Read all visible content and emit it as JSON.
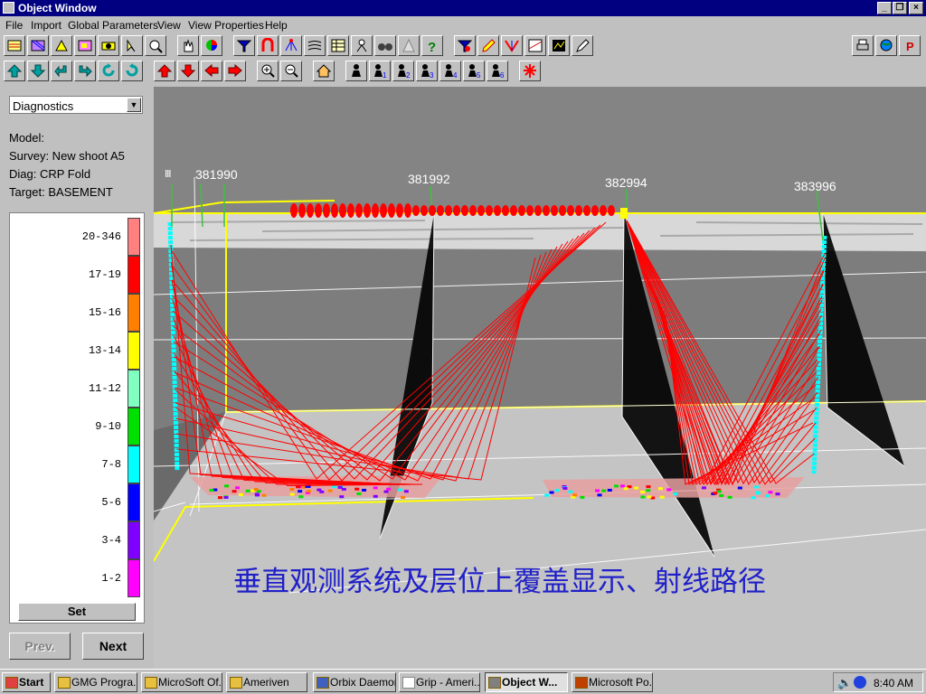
{
  "window": {
    "title": "Object Window"
  },
  "menu": [
    "File",
    "Import",
    "Global Parameters",
    "View",
    "View Properties",
    "Help"
  ],
  "sidebar": {
    "dropdown_value": "Diagnostics",
    "model_label": "Model:",
    "survey": "Survey: New shoot A5",
    "diag": "Diag: CRP Fold",
    "target": "Target: BASEMENT",
    "legend": [
      {
        "label": "20-346",
        "color": "#ff8080"
      },
      {
        "label": "17-19",
        "color": "#ff0000"
      },
      {
        "label": "15-16",
        "color": "#ff8000"
      },
      {
        "label": "13-14",
        "color": "#ffff00"
      },
      {
        "label": "11-12",
        "color": "#80ffc0"
      },
      {
        "label": "9-10",
        "color": "#00e000"
      },
      {
        "label": "7-8",
        "color": "#00ffff"
      },
      {
        "label": "5-6",
        "color": "#0000ff"
      },
      {
        "label": "3-4",
        "color": "#8000ff"
      },
      {
        "label": "1-2",
        "color": "#ff00ff"
      }
    ],
    "set_label": "Set",
    "prev_label": "Prev.",
    "next_label": "Next"
  },
  "view": {
    "wells": [
      "381990",
      "381992",
      "382994",
      "383996"
    ],
    "caption": "垂直观测系统及层位上覆盖显示、射线路径"
  },
  "taskbar": {
    "start": "Start",
    "tasks": [
      "GMG Progra...",
      "MicroSoft Of...",
      "Ameriven",
      "Orbix Daemon",
      "Grip - Ameri...",
      "Object W...",
      "Microsoft Po..."
    ],
    "clock": "8:40 AM"
  },
  "colors": {
    "titlebar": "#000080",
    "raypath": "#ff0000",
    "receiver": "#00ffff",
    "horizon_outline": "#ffff00"
  }
}
